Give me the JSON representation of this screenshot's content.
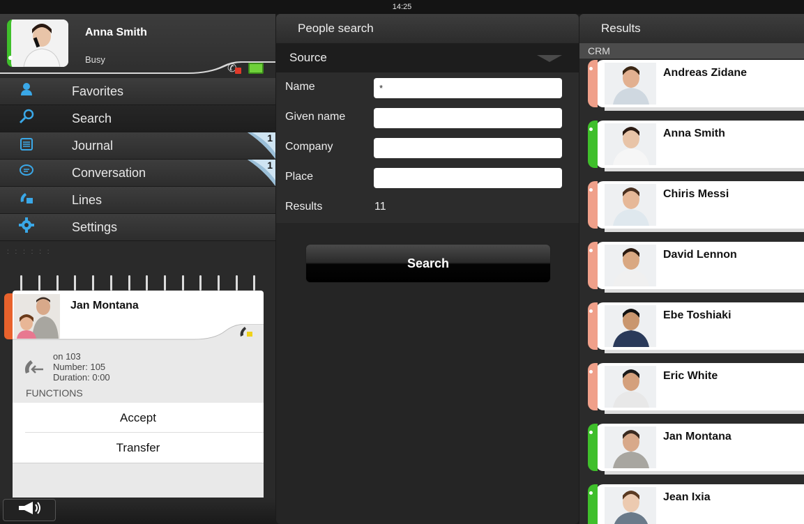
{
  "statusbar": {
    "time": "14:25"
  },
  "profile": {
    "name": "Anna Smith",
    "status": "Busy"
  },
  "menu": {
    "items": [
      {
        "label": "Favorites",
        "icon": "person-icon"
      },
      {
        "label": "Search",
        "icon": "search-icon"
      },
      {
        "label": "Journal",
        "icon": "journal-icon",
        "badge": "1"
      },
      {
        "label": "Conversation",
        "icon": "chat-icon",
        "badge": "1"
      },
      {
        "label": "Lines",
        "icon": "phone-lines-icon"
      },
      {
        "label": "Settings",
        "icon": "gear-icon"
      }
    ]
  },
  "call": {
    "caller": "Jan Montana",
    "on": "on 103",
    "number": "Number: 105",
    "duration": "Duration: 0:00",
    "functions_label": "FUNCTIONS",
    "accept_label": "Accept",
    "transfer_label": "Transfer"
  },
  "people_search": {
    "title": "People search",
    "source_label": "Source",
    "fields": {
      "name_label": "Name",
      "name_value": "*",
      "given_name_label": "Given name",
      "given_name_value": "",
      "company_label": "Company",
      "company_value": "",
      "place_label": "Place",
      "place_value": ""
    },
    "results_label": "Results",
    "results_count": "11",
    "search_button": "Search"
  },
  "results": {
    "title": "Results",
    "section": "CRM",
    "contacts": [
      {
        "name": "Andreas Zidane",
        "accent": "#f0a08a"
      },
      {
        "name": "Anna Smith",
        "accent": "#3fbf2b"
      },
      {
        "name": "Chiris Messi",
        "accent": "#f0a08a"
      },
      {
        "name": "David Lennon",
        "accent": "#f0a08a"
      },
      {
        "name": "Ebe Toshiaki",
        "accent": "#f0a08a"
      },
      {
        "name": "Eric White",
        "accent": "#f0a08a"
      },
      {
        "name": "Jan Montana",
        "accent": "#3fbf2b"
      },
      {
        "name": "Jean Ixia",
        "accent": "#3fbf2b"
      }
    ]
  },
  "colors": {
    "accent_blue": "#3aa8e8",
    "busy_green": "#3fbf2b",
    "caller_orange": "#e8622c"
  }
}
